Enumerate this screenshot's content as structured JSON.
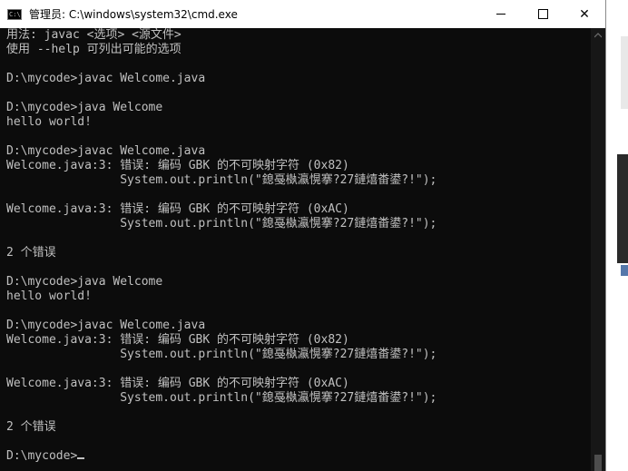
{
  "window": {
    "title": "管理员: C:\\windows\\system32\\cmd.exe",
    "icon_text": "C:\\",
    "minimize_icon": "minimize-icon",
    "maximize_icon": "maximize-icon",
    "close_label": "✕"
  },
  "console": {
    "lines": [
      "用法: javac <选项> <源文件>",
      "使用 --help 可列出可能的选项",
      "",
      "D:\\mycode>javac Welcome.java",
      "",
      "D:\\mycode>java Welcome",
      "hello world!",
      "",
      "D:\\mycode>javac Welcome.java",
      "Welcome.java:3: 错误: 编码 GBK 的不可映射字符 (0x82)",
      "                System.out.println(\"鎴戞槸瀛愰搴?27鏈熺畨鍙?!\");",
      "",
      "Welcome.java:3: 错误: 编码 GBK 的不可映射字符 (0xAC)",
      "                System.out.println(\"鎴戞槸瀛愰搴?27鏈熺畨鍙?!\");",
      "",
      "2 个错误",
      "",
      "D:\\mycode>java Welcome",
      "hello world!",
      "",
      "D:\\mycode>javac Welcome.java",
      "Welcome.java:3: 错误: 编码 GBK 的不可映射字符 (0x82)",
      "                System.out.println(\"鎴戞槸瀛愰搴?27鏈熺畨鍙?!\");",
      "",
      "Welcome.java:3: 错误: 编码 GBK 的不可映射字符 (0xAC)",
      "                System.out.println(\"鎴戞槸瀛愰搴?27鏈熺畨鍙?!\");",
      "",
      "2 个错误",
      ""
    ],
    "prompt": "D:\\mycode>"
  },
  "colors": {
    "console_bg": "#0c0c0c",
    "console_fg": "#c0c0c0",
    "titlebar_bg": "#ffffff"
  }
}
